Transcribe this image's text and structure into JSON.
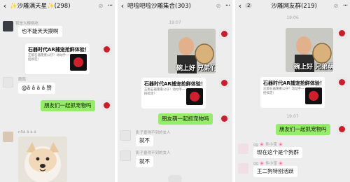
{
  "panels": [
    {
      "header": {
        "back_glyph": "‹",
        "title": "✨沙雕满天星✨(298)",
        "mute_glyph": "⊘",
        "more_glyph": "···"
      },
      "messages": {
        "sender1_name": "我是大樱桃吃",
        "sender1_text": "也不能天天摸啊",
        "card_title": "石器时代AR捕宠抢鲜体验！",
        "card_desc": "正版石器隆重公仔！动动手一招搞定!",
        "sender2_name": "蘑菇",
        "sender2_text": "@ă ǎ à á 赞",
        "own_text": "朋友们一起抓宠物吗",
        "sender3_name": "n5ă ǎ à á"
      }
    },
    {
      "header": {
        "back_glyph": "‹",
        "title": "吧啦吧啦沙雕集合(303)",
        "mute_glyph": "⊘",
        "more_glyph": "···"
      },
      "messages": {
        "time": "19:07",
        "photo_caption": "碗上好 兄弟们",
        "card_title": "石器时代AR捕宠抢鲜体验！",
        "card_desc": "正版石器隆重公仔！动动手一招搞定!",
        "own_text": "朋友萌一起抓宠物吗",
        "sender1_name": "影子垂得不到的女人",
        "sender1_text": "就不",
        "sender2_name": "影子垂得不到的女人",
        "sender2_text": "就不"
      }
    },
    {
      "header": {
        "back_glyph": "‹",
        "unread": "2",
        "title": "沙雕网友群(219)",
        "mute_glyph": "⊘",
        "more_glyph": "···"
      },
      "messages": {
        "time1": "19:06",
        "photo_caption": "碗上好 兄弟萌",
        "card_title": "石器时代AR捕宠抢鲜体验！",
        "card_desc": "正版石器隆重公仔！动动手一招搞定!",
        "time2": "19:07",
        "own_text": "朋友们一起抓宠物吗",
        "sender1_name": "gg 🌸 件小宝 🌸",
        "sender1_text": "现在这个是个狗群",
        "sender2_name": "gg 🌸 件小宝 🌸",
        "sender2_text": "王二狗特别活跃"
      }
    }
  ]
}
